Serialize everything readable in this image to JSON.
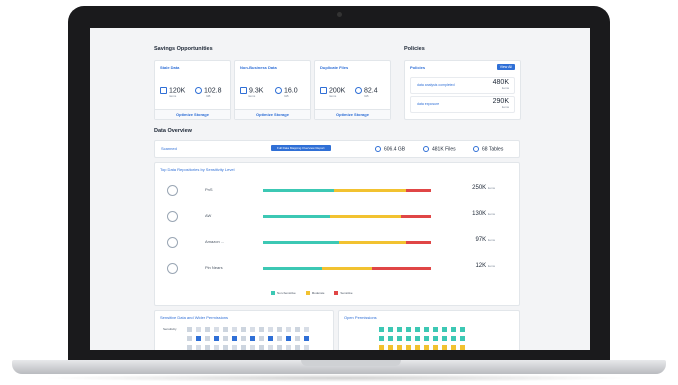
{
  "savings": {
    "title": "Savings Opportunities",
    "cards": [
      {
        "title": "Stale Data",
        "stat1_value": "120K",
        "stat1_unit": "items",
        "stat2_value": "102.8",
        "stat2_unit": "GB",
        "action": "Optimize Storage"
      },
      {
        "title": "Non-Business Data",
        "stat1_value": "9.3K",
        "stat1_unit": "items",
        "stat2_value": "16.0",
        "stat2_unit": "GB",
        "action": "Optimize Storage"
      },
      {
        "title": "Duplicate Files",
        "stat1_value": "200K",
        "stat1_unit": "items",
        "stat2_value": "82.4",
        "stat2_unit": "GB",
        "action": "Optimize Storage"
      }
    ]
  },
  "policies": {
    "title": "Policies",
    "card_title": "Policies",
    "pill": "View All",
    "rows": [
      {
        "label": "data analysis completed",
        "value": "480K",
        "unit": "items"
      },
      {
        "label": "data exposure",
        "value": "290K",
        "unit": "items"
      }
    ]
  },
  "overview": {
    "title": "Data Overview",
    "source": "Scanned",
    "report_button": "Full Data Mapping Overview Report",
    "size": "606.4 GB",
    "files": "481K Files",
    "tables": "68 Tables"
  },
  "repos": {
    "title": "Top Data Repositories by Sensitivity Level",
    "items": [
      {
        "name": "PnS",
        "value": "250K",
        "unit": "items",
        "levels": [
          0.42,
          0.43,
          0.15
        ]
      },
      {
        "name": "AW",
        "value": "130K",
        "unit": "items",
        "levels": [
          0.4,
          0.42,
          0.18
        ]
      },
      {
        "name": "Amazon ...",
        "value": "97K",
        "unit": "items",
        "levels": [
          0.45,
          0.4,
          0.15
        ]
      },
      {
        "name": "Pin Nears",
        "value": "12K",
        "unit": "items",
        "levels": [
          0.35,
          0.3,
          0.35
        ]
      }
    ],
    "legend": [
      "Non-Sensitive",
      "Moderate",
      "Sensitive"
    ],
    "colors": [
      "#3cc8b4",
      "#f2c230",
      "#e04646"
    ]
  },
  "bottom": {
    "left_title": "Sensitive Data and Wider Permissions",
    "right_title": "Open Permissions",
    "row_label": "Sensitivity"
  },
  "colors": {
    "accent": "#2f6fd6",
    "teal": "#3cc8b4",
    "yellow": "#f2c230",
    "red": "#e04646"
  }
}
